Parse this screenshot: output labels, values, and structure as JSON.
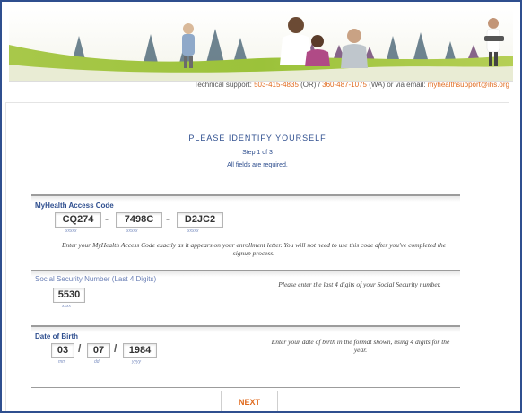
{
  "support": {
    "label": "Technical support:",
    "phone_or": "503-415-4835",
    "or_region": "(OR) /",
    "phone_wa": "360-487-1075",
    "wa_text": "(WA) or via email:",
    "email": "myhealthsupport@ihs.org"
  },
  "form": {
    "title": "PLEASE IDENTIFY YOURSELF",
    "step": "Step 1 of 3",
    "required_note": "All fields are required."
  },
  "access_code": {
    "label": "MyHealth Access Code",
    "part1": "CQ274",
    "part2": "7498C",
    "part3": "D2JC2",
    "hint": "xxxxx",
    "separator": "-",
    "instructions": "Enter your MyHealth Access Code exactly as it appears on your enrollment letter. You will not need to use this code after you've completed the signup process."
  },
  "ssn": {
    "label": "Social Security Number (Last 4 Digits)",
    "value": "5530",
    "hint": "xxxx",
    "instructions": "Please enter the last 4 digits of your Social Security number."
  },
  "dob": {
    "label": "Date of Birth",
    "month": "03",
    "day": "07",
    "year": "1984",
    "separator": "/",
    "hint_month": "mm",
    "hint_day": "dd",
    "hint_year": "yyyy",
    "instructions": "Enter your date of birth in the format shown, using 4 digits for the year."
  },
  "next_label": "NEXT",
  "colors": {
    "accent_blue": "#2f4f8f",
    "link_orange": "#e06b1f",
    "banner_green": "#9bc23a"
  }
}
